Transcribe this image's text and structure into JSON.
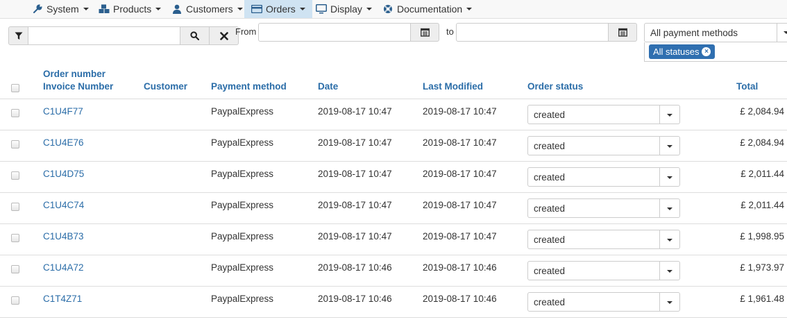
{
  "nav": {
    "items": [
      {
        "label": "System",
        "icon": "wrench-icon"
      },
      {
        "label": "Products",
        "icon": "cubes-icon"
      },
      {
        "label": "Customers",
        "icon": "user-icon"
      },
      {
        "label": "Orders",
        "icon": "credit-card-icon",
        "active": true
      },
      {
        "label": "Display",
        "icon": "monitor-icon"
      },
      {
        "label": "Documentation",
        "icon": "lifebuoy-icon"
      }
    ]
  },
  "filters": {
    "search_value": "",
    "from_label": "From",
    "to_label": "to",
    "from_value": "",
    "to_value": "",
    "payment_method": "All payment methods",
    "status_tag": "All statuses"
  },
  "table": {
    "headers": {
      "order_number": "Order number",
      "invoice_number": "Invoice Number",
      "customer": "Customer",
      "payment_method": "Payment method",
      "date": "Date",
      "last_modified": "Last Modified",
      "order_status": "Order status",
      "total": "Total"
    },
    "rows": [
      {
        "order": "C1U4F77",
        "customer": "",
        "payment": "PaypalExpress",
        "date": "2019-08-17 10:47",
        "modified": "2019-08-17 10:47",
        "status": "created",
        "total": "£ 2,084.94"
      },
      {
        "order": "C1U4E76",
        "customer": "",
        "payment": "PaypalExpress",
        "date": "2019-08-17 10:47",
        "modified": "2019-08-17 10:47",
        "status": "created",
        "total": "£ 2,084.94"
      },
      {
        "order": "C1U4D75",
        "customer": "",
        "payment": "PaypalExpress",
        "date": "2019-08-17 10:47",
        "modified": "2019-08-17 10:47",
        "status": "created",
        "total": "£ 2,011.44"
      },
      {
        "order": "C1U4C74",
        "customer": "",
        "payment": "PaypalExpress",
        "date": "2019-08-17 10:47",
        "modified": "2019-08-17 10:47",
        "status": "created",
        "total": "£ 2,011.44"
      },
      {
        "order": "C1U4B73",
        "customer": "",
        "payment": "PaypalExpress",
        "date": "2019-08-17 10:47",
        "modified": "2019-08-17 10:47",
        "status": "created",
        "total": "£ 1,998.95"
      },
      {
        "order": "C1U4A72",
        "customer": "",
        "payment": "PaypalExpress",
        "date": "2019-08-17 10:46",
        "modified": "2019-08-17 10:46",
        "status": "created",
        "total": "£ 1,973.97"
      },
      {
        "order": "C1T4Z71",
        "customer": "",
        "payment": "PaypalExpress",
        "date": "2019-08-17 10:46",
        "modified": "2019-08-17 10:46",
        "status": "created",
        "total": "£ 1,961.48"
      }
    ]
  },
  "colors": {
    "link": "#2b6da8",
    "active_nav": "#cfe3f2",
    "tag_bg": "#2f6fb0"
  }
}
